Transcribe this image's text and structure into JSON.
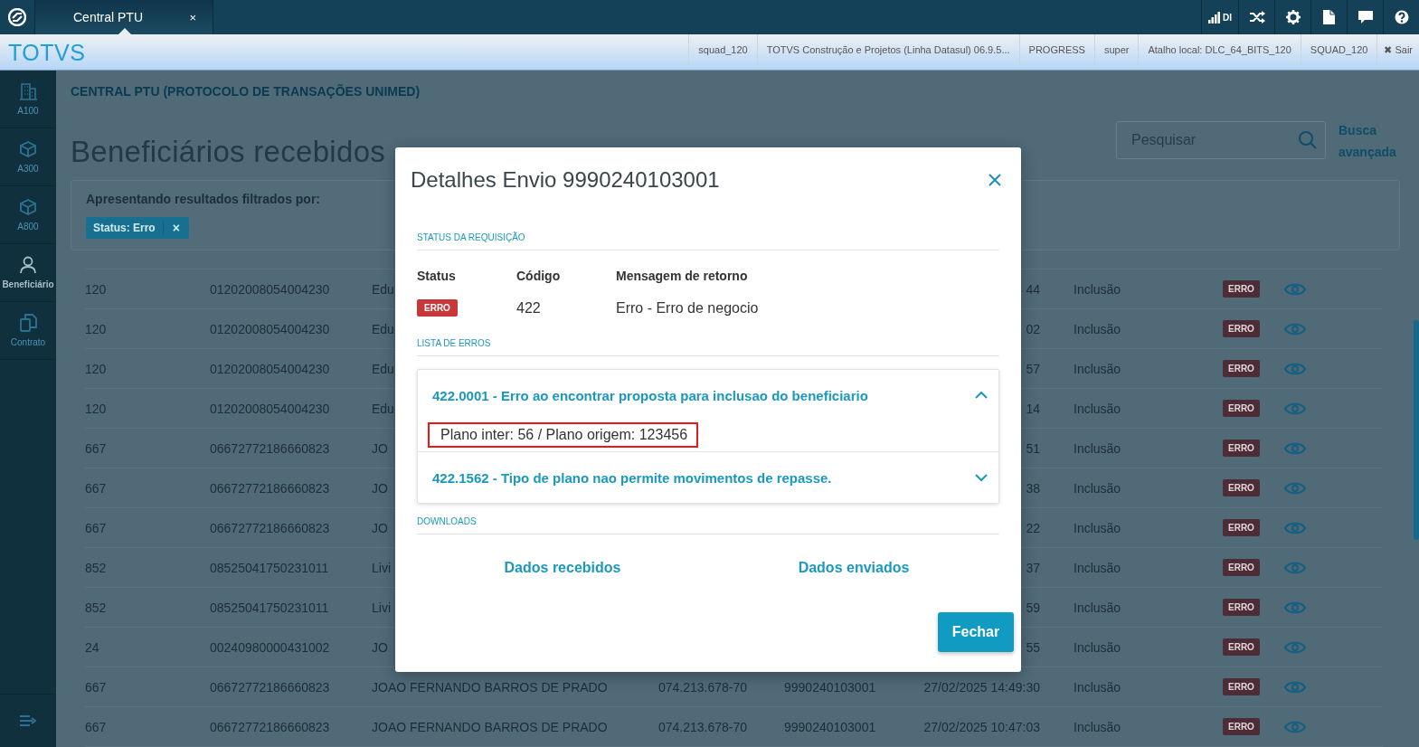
{
  "top_bar": {
    "tab": {
      "label": "Central PTU",
      "close": "×",
      "selected": true
    },
    "signal_label": "DI"
  },
  "info_bar": {
    "logo": "TOTVS",
    "items": [
      "squad_120",
      "TOTVS Construção e Projetos (Linha Datasul) 06.9.5...",
      "PROGRESS",
      "super",
      "Atalho local: DLC_64_BITS_120",
      "SQUAD_120"
    ],
    "logout": {
      "icon": "✖",
      "label": "Sair"
    }
  },
  "sidebar": {
    "items": [
      {
        "label": "A100",
        "selected": false
      },
      {
        "label": "A300",
        "selected": false
      },
      {
        "label": "A800",
        "selected": false
      },
      {
        "label": "Beneficiário",
        "selected": true
      },
      {
        "label": "Contrato",
        "selected": false
      }
    ]
  },
  "page": {
    "breadcrumb": "CENTRAL PTU (PROTOCOLO DE TRANSAÇÕES UNIMED)",
    "title": "Beneficiários recebidos",
    "search": {
      "placeholder": "Pesquisar"
    },
    "advanced_search": "Busca avançada",
    "filter": {
      "label": "Apresentando resultados filtrados por:",
      "chips": [
        {
          "label": "Status: Erro",
          "remove": "×"
        }
      ]
    }
  },
  "table": {
    "rows": [
      {
        "column_1": "120",
        "column_2": "01202008054004230",
        "column_3": "Edu",
        "column_6": "44",
        "column_7": "Inclusão",
        "status": "ERRO"
      },
      {
        "column_1": "120",
        "column_2": "01202008054004230",
        "column_3": "Edu",
        "column_6": "02",
        "column_7": "Inclusão",
        "status": "ERRO"
      },
      {
        "column_1": "120",
        "column_2": "01202008054004230",
        "column_3": "Edu",
        "column_6": "57",
        "column_7": "Inclusão",
        "status": "ERRO"
      },
      {
        "column_1": "120",
        "column_2": "01202008054004230",
        "column_3": "Edu",
        "column_6": "14",
        "column_7": "Inclusão",
        "status": "ERRO"
      },
      {
        "column_1": "667",
        "column_2": "06672772186660823",
        "column_3": "JO",
        "column_6": "51",
        "column_7": "Inclusão",
        "status": "ERRO"
      },
      {
        "column_1": "667",
        "column_2": "06672772186660823",
        "column_3": "JO",
        "column_6": "38",
        "column_7": "Inclusão",
        "status": "ERRO"
      },
      {
        "column_1": "667",
        "column_2": "06672772186660823",
        "column_3": "JO",
        "column_6": "22",
        "column_7": "Inclusão",
        "status": "ERRO"
      },
      {
        "column_1": "852",
        "column_2": "08525041750231011",
        "column_3": "Livi",
        "column_6": "37",
        "column_7": "Inclusão",
        "status": "ERRO"
      },
      {
        "column_1": "852",
        "column_2": "08525041750231011",
        "column_3": "Livi",
        "column_6": "59",
        "column_7": "Inclusão",
        "status": "ERRO"
      },
      {
        "column_1": "24",
        "column_2": "00240980000431002",
        "column_3": "JO",
        "column_6": "55",
        "column_7": "Inclusão",
        "status": "ERRO"
      },
      {
        "column_1": "667",
        "column_2": "06672772186660823",
        "column_3": "JOAO FERNANDO BARROS DE PRADO",
        "column_4": "074.213.678-70",
        "column_5": "9990240103001",
        "column_6": "27/02/2025 14:49:30",
        "column_7": "Inclusão",
        "status": "ERRO"
      },
      {
        "column_1": "667",
        "column_2": "06672772186660823",
        "column_3": "JOAO FERNANDO BARROS DE PRADO",
        "column_4": "074.213.678-70",
        "column_5": "9990240103001",
        "column_6": "27/02/2025 10:47:03",
        "column_7": "Inclusão",
        "status": "ERRO"
      }
    ]
  },
  "modal": {
    "title": "Detalhes Envio 9990240103001",
    "status_section": {
      "heading": "STATUS DA REQUISIÇÃO",
      "columns": [
        "Status",
        "Código",
        "Mensagem de retorno"
      ],
      "status": "ERRO",
      "code": "422",
      "message": "Erro - Erro de negocio"
    },
    "errors_section": {
      "heading": "LISTA DE ERROS",
      "items": [
        {
          "title": "422.0001 - Erro ao encontrar proposta para inclusao do beneficiario",
          "expanded": true,
          "detail": "Plano inter: 56 / Plano origem: 123456",
          "highlighted": true
        },
        {
          "title": "422.1562 - Tipo de plano nao permite movimentos de repasse.",
          "expanded": false
        }
      ]
    },
    "downloads_section": {
      "heading": "DOWNLOADS",
      "links": [
        "Dados recebidos",
        "Dados enviados"
      ]
    },
    "buttons": [
      "Fechar"
    ]
  }
}
